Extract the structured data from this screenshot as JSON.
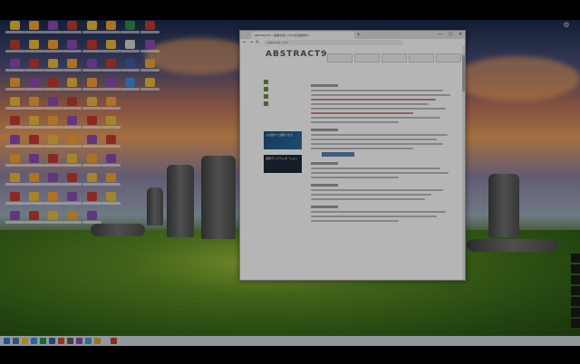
{
  "browser": {
    "tab_title": "ABSTRACT9 ～画像を使ってPCを自動操作～",
    "new_tab": "+",
    "address": "abstract9.com/…",
    "back": "←",
    "forward": "→",
    "reload": "↻",
    "minimize": "—",
    "maximize": "☐",
    "close": "✕"
  },
  "site": {
    "logo": "ABSTRACT9",
    "tagline": "",
    "nav": [
      "",
      "",
      "",
      "",
      ""
    ],
    "sidebar_links": [
      "",
      "",
      "",
      ""
    ],
    "ad1": "入社後すぐ活躍できる",
    "ad2": "週末ディスティネーション"
  },
  "taskbar": {
    "tray_text": ""
  },
  "desktop": {
    "gear_label": ""
  },
  "colors": {
    "taskbar_bg": "#cdd3dd",
    "accent": "#5c7fb2"
  }
}
